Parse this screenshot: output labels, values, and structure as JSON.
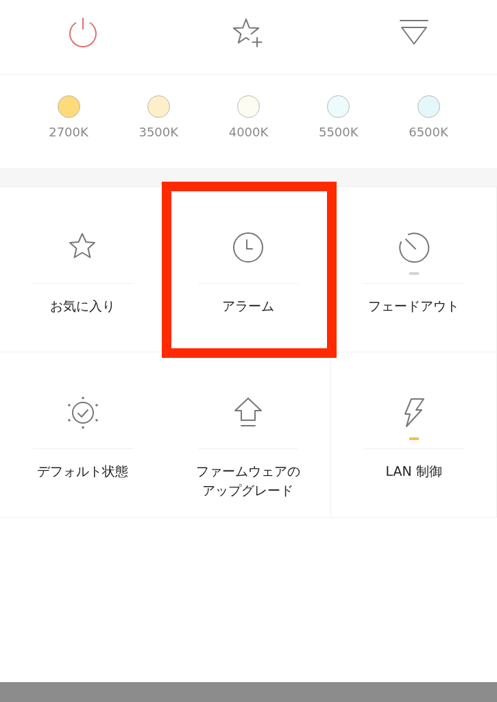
{
  "toolbar": [
    {
      "kind": "power"
    },
    {
      "kind": "favorite-add"
    },
    {
      "kind": "menu"
    }
  ],
  "color_temperatures": [
    {
      "label": "2700K",
      "color": "#fddb7a"
    },
    {
      "label": "3500K",
      "color": "#fdf0c8"
    },
    {
      "label": "4000K",
      "color": "#fdfcf3"
    },
    {
      "label": "5500K",
      "color": "#eefbfc"
    },
    {
      "label": "6500K",
      "color": "#e4f7fb"
    }
  ],
  "features": [
    {
      "kind": "favorites",
      "label": "お気に入り",
      "highlighted": false
    },
    {
      "kind": "alarm",
      "label": "アラーム",
      "highlighted": true
    },
    {
      "kind": "fade",
      "label": "フェードアウト",
      "highlighted": false,
      "on": false
    },
    {
      "kind": "default",
      "label": "デフォルト状態",
      "highlighted": false
    },
    {
      "kind": "firmware",
      "label": "ファームウェアのアップグレード",
      "highlighted": false
    },
    {
      "kind": "lan",
      "label": "LAN 制御",
      "highlighted": false,
      "on": true
    }
  ]
}
